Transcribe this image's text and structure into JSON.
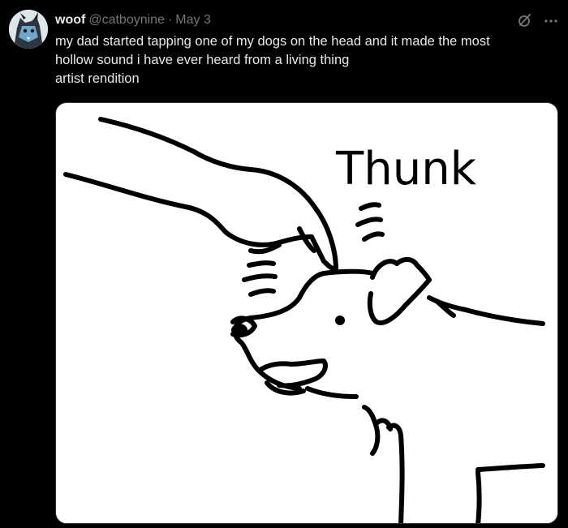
{
  "tweet": {
    "author_name": "woof",
    "handle": "@catboynine",
    "separator": "·",
    "date": "May 3",
    "text_lines": [
      "my dad started tapping one of my dogs on the head and it made the most",
      "hollow sound i have ever heard from a living thing",
      "artist rendition"
    ],
    "drawing_text": "Thunk"
  },
  "icons": {
    "grok": "grok-icon",
    "more": "more-icon"
  },
  "colors": {
    "background": "#000000",
    "primary_text": "#e7e9ea",
    "secondary_text": "#71767b"
  }
}
